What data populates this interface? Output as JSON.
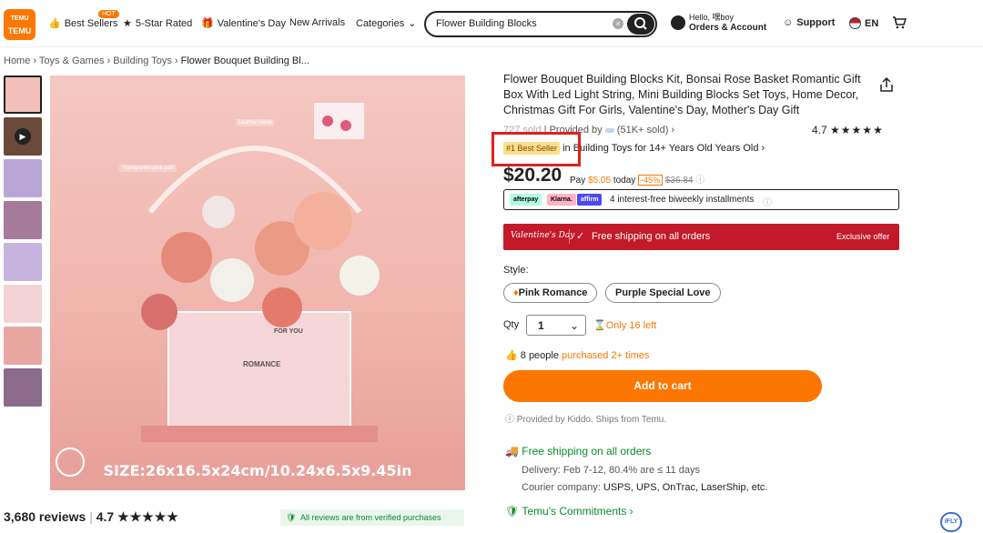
{
  "header": {
    "logo_top": "TEMU",
    "logo_bottom": "TEMU",
    "nav": [
      {
        "label": "Best Sellers",
        "badge": "HOT"
      },
      {
        "label": "5-Star Rated"
      },
      {
        "label": "Valentine's Day"
      },
      {
        "label": "New Arrivals"
      },
      {
        "label": "Categories"
      }
    ],
    "search_value": "Flower Building Blocks",
    "account_hello": "Hello, 嘿boy",
    "account_label": "Orders & Account",
    "support": "Support",
    "lang": "EN"
  },
  "breadcrumb": [
    "Home",
    "Toys & Games",
    "Building Toys",
    "Flower Bouquet Building Bl..."
  ],
  "gallery": {
    "size_caption": "SIZE:26x16.5x24cm/10.24x6.5x9.45in",
    "label_leather": "Leather Hand",
    "label_transparent": "Transparent pink part",
    "box_text": "ROMANCE",
    "box_for": "FOR YOU"
  },
  "product": {
    "title": "Flower Bouquet Building Blocks Kit, Bonsai Rose Basket Romantic Gift Box With Led Light String, Mini Building Blocks Set Toys, Home Decor, Christmas Gift For Girls, Valentine's Day, Mother's Day Gift",
    "sold": "727 sold",
    "provided_by": "Provided by",
    "provider_sold": "(51K+ sold)",
    "rating": "4.7",
    "bestseller_badge": "#1 Best Seller",
    "bestseller_in": "in Building Toys for 14+ Years Old Years Old",
    "price": "$20.20",
    "pay_prefix": "Pay",
    "pay_amount": "$5.05",
    "pay_today": "today",
    "discount": "-45%",
    "original": "$36.84",
    "afterpay": "afterpay",
    "klarna": "Klarna.",
    "affirm": "affirm",
    "installments": "4 interest-free biweekly installments",
    "banner_script": "Valentine's Day",
    "banner_ship": "Free shipping on all orders",
    "banner_excl": "Exclusive offer",
    "style_label": "Style:",
    "style_opts": [
      "Pink Romance",
      "Purple Special Love"
    ],
    "qty_label": "Qty",
    "qty_value": "1",
    "stock": "Only 16 left",
    "people_count": "8 people",
    "people_suffix": "purchased 2+ times",
    "cart": "Add to cart",
    "provided_note": "Provided by Kiddo. Ships from Temu.",
    "free_ship": "Free shipping on all orders",
    "delivery": "Delivery: Feb 7-12, 80.4% are ≤ 11 days",
    "courier_label": "Courier company:",
    "couriers": "USPS, UPS, OnTrac, LaserShip, etc.",
    "commitments": "Temu's Commitments"
  },
  "reviews": {
    "count": "3,680 reviews",
    "rating": "4.7",
    "verified": "All reviews are from verified purchases"
  },
  "ifly": "iFLY",
  "colors": {
    "accent": "#fb7701",
    "green": "#0a8a2a",
    "red": "#c21a2a"
  }
}
